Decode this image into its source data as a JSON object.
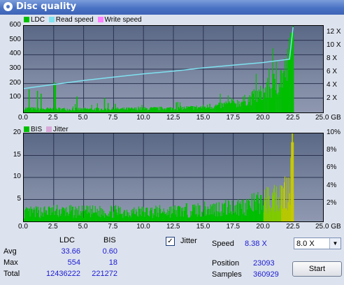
{
  "window": {
    "title": "Disc quality"
  },
  "chart_data": [
    {
      "type": "bar",
      "legend": [
        "LDC",
        "Read speed",
        "Write speed"
      ],
      "colors": {
        "ldc": "#00bf00",
        "read_speed": "#7ee2f0",
        "write_speed": "#ff80ff"
      },
      "xlim": [
        0,
        25
      ],
      "xticks": [
        "0.0",
        "2.5",
        "5.0",
        "7.5",
        "10.0",
        "12.5",
        "15.0",
        "17.5",
        "20.0",
        "22.5",
        "25.0 GB"
      ],
      "ylim": [
        0,
        600
      ],
      "yticks": [
        "100",
        "200",
        "300",
        "400",
        "500",
        "600"
      ],
      "y2lim": [
        0,
        13
      ],
      "y2ticks": [
        "2 X",
        "4 X",
        "6 X",
        "8 X",
        "10 X",
        "12 X"
      ],
      "ldc_profile": {
        "x": [
          0,
          1,
          2,
          3,
          4,
          5,
          6,
          7,
          8,
          9,
          10,
          11,
          12,
          13,
          14,
          15,
          16,
          17,
          18,
          19,
          20,
          21,
          22,
          22.5
        ],
        "y": [
          28,
          25,
          24,
          24,
          23,
          23,
          24,
          24,
          24,
          25,
          26,
          27,
          28,
          30,
          33,
          37,
          44,
          55,
          70,
          100,
          140,
          200,
          300,
          554
        ]
      },
      "ldc_spikes": {
        "x": [
          0.4,
          1.1,
          1.4,
          2.5,
          2.6,
          4.4,
          6.7,
          7.0,
          7.6,
          12.7,
          15.5,
          17.6
        ],
        "y": [
          160,
          150,
          130,
          210,
          190,
          110,
          100,
          65,
          60,
          70,
          60,
          60
        ]
      },
      "read_speed": {
        "x": [
          0,
          2.5,
          5,
          7.5,
          10,
          12.5,
          15,
          17.5,
          20,
          22.2,
          22.5
        ],
        "y": [
          3.6,
          4.2,
          4.8,
          5.3,
          5.8,
          6.2,
          6.7,
          7.1,
          7.5,
          8.0,
          12.8
        ]
      }
    },
    {
      "type": "bar",
      "legend": [
        "BIS",
        "Jitter"
      ],
      "colors": {
        "bis": "#00bf00",
        "jitter": "#d8a8d8"
      },
      "xlim": [
        0,
        25
      ],
      "xticks": [
        "0.0",
        "2.5",
        "5.0",
        "7.5",
        "10.0",
        "12.5",
        "15.0",
        "17.5",
        "20.0",
        "22.5",
        "25.0 GB"
      ],
      "ylim": [
        0,
        20
      ],
      "yticks": [
        "5",
        "10",
        "15",
        "20"
      ],
      "y2lim": [
        0,
        10
      ],
      "y2ticks": [
        "2%",
        "4%",
        "6%",
        "8%",
        "10%"
      ],
      "bis_profile": {
        "x": [
          0,
          2.5,
          5,
          7.5,
          10,
          12.5,
          15,
          17.5,
          19,
          20,
          21,
          22,
          22.5
        ],
        "y": [
          2.2,
          2.6,
          2.4,
          2.5,
          2.4,
          2.6,
          3.0,
          3.6,
          4.2,
          5.0,
          6.2,
          8.0,
          18
        ]
      }
    }
  ],
  "stats": {
    "headers": {
      "ldc": "LDC",
      "bis": "BIS"
    },
    "rows": {
      "avg": {
        "label": "Avg",
        "ldc": "33.66",
        "bis": "0.60"
      },
      "max": {
        "label": "Max",
        "ldc": "554",
        "bis": "18"
      },
      "total": {
        "label": "Total",
        "ldc": "12436222",
        "bis": "221272"
      }
    }
  },
  "controls": {
    "jitter_label": "Jitter",
    "jitter_checked": "✓",
    "speed_label": "Speed",
    "speed_value": "8.38 X",
    "speed_select": "8.0 X",
    "position_label": "Position",
    "position_value": "23093",
    "samples_label": "Samples",
    "samples_value": "360929",
    "start_label": "Start"
  }
}
